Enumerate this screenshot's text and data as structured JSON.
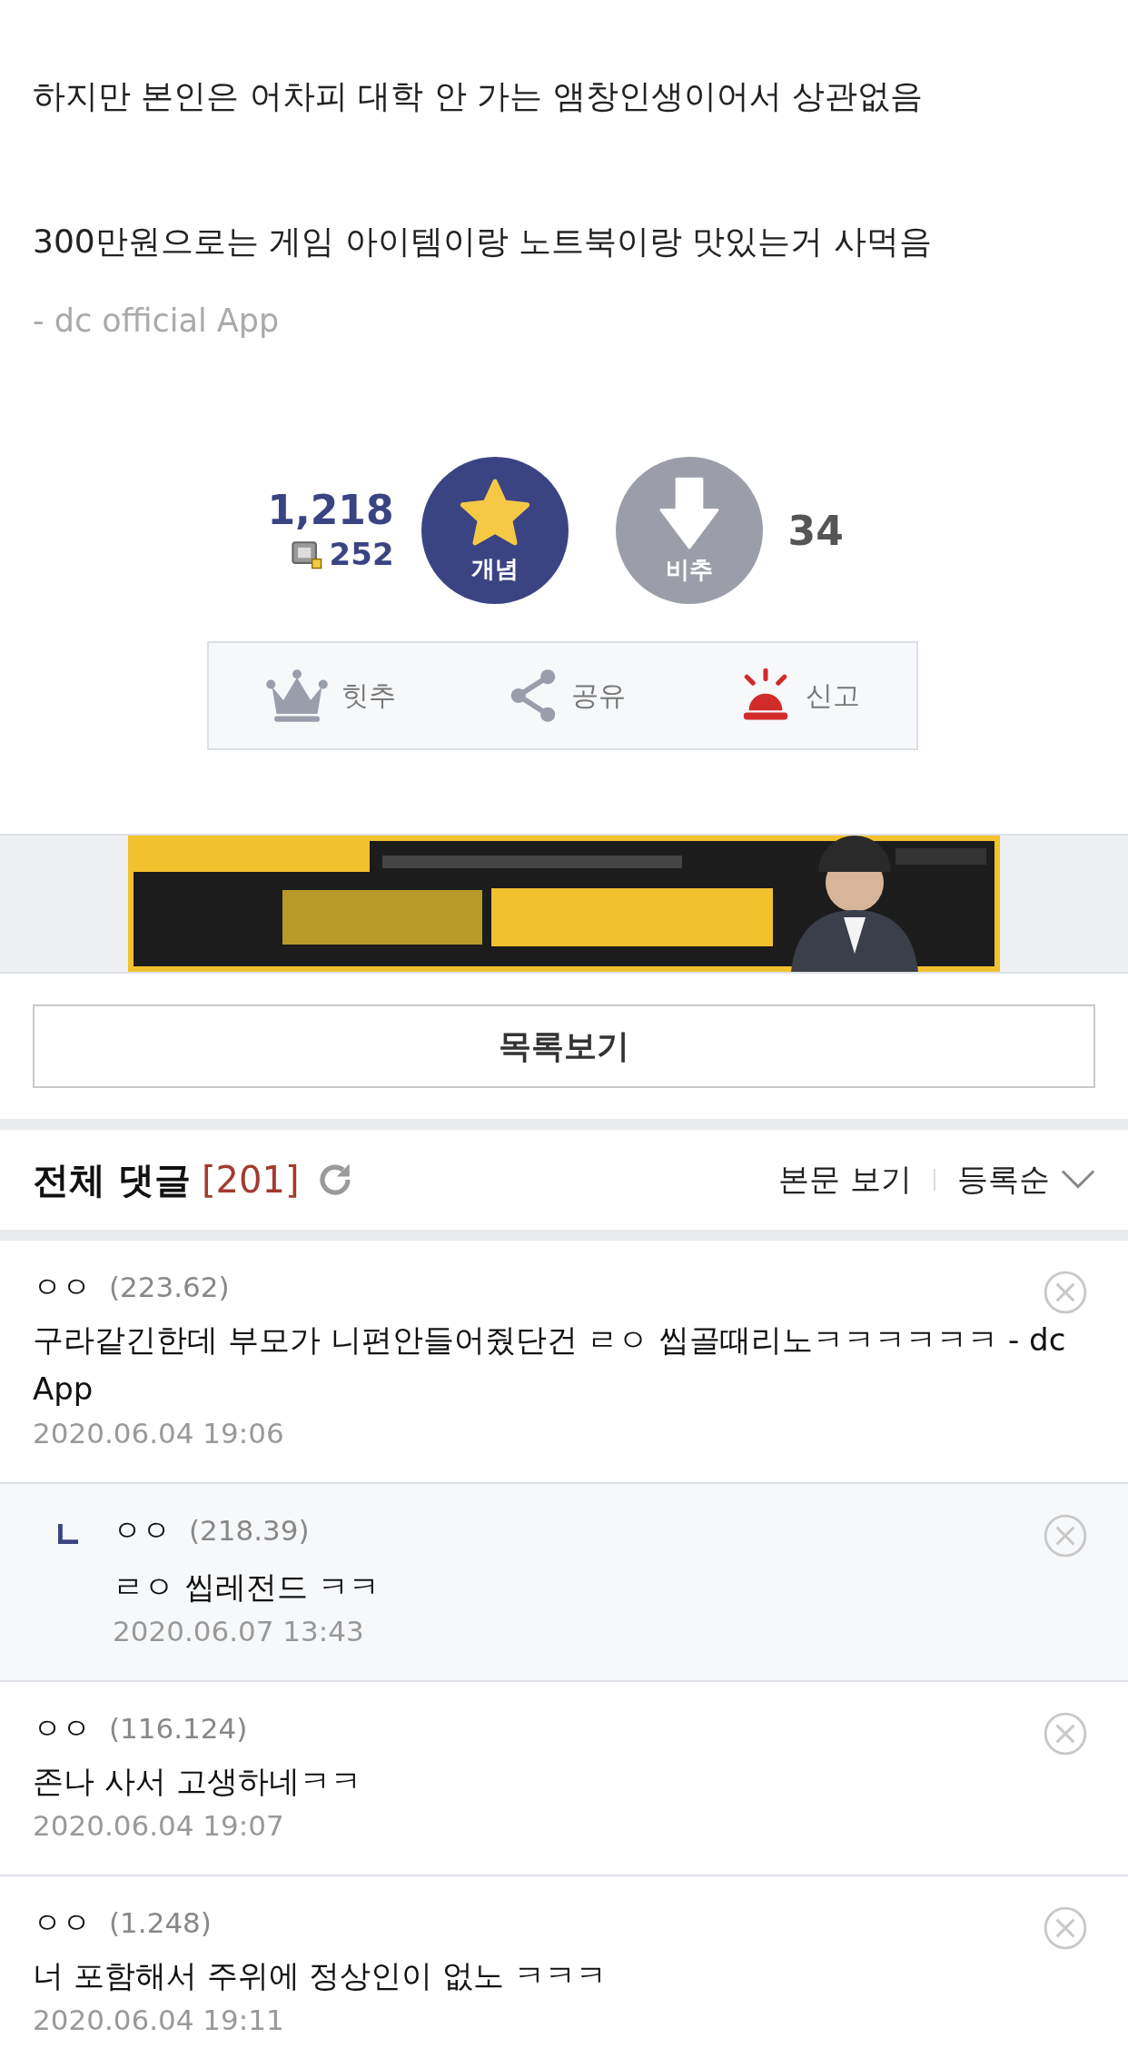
{
  "post": {
    "paragraphs": [
      "하지만 본인은 어차피 대학 안 가는 앰창인생이어서 상관없음",
      "300만원으로는 게임 아이템이랑 노트북이랑 맛있는거 사먹음"
    ],
    "signature": "- dc official App"
  },
  "votes": {
    "up_count": "1,218",
    "fixed_count": "252",
    "up_label": "개념",
    "down_label": "비추",
    "down_count": "34"
  },
  "actions": [
    {
      "kind": "hit",
      "label": "힛추"
    },
    {
      "kind": "share",
      "label": "공유"
    },
    {
      "kind": "report",
      "label": "신고"
    }
  ],
  "list_button": "목록보기",
  "comments_header": {
    "title": "전체 댓글",
    "count": "[201]",
    "view_post": "본문 보기",
    "sort": "등록순"
  },
  "comments": [
    {
      "kind": "comment",
      "author": "ㅇㅇ",
      "ip": "(223.62)",
      "text": "구라같긴한데 부모가 니편안들어줬단건 ㄹㅇ 씹골때리노ㅋㅋㅋㅋㅋㅋ - dc App",
      "date": "2020.06.04 19:06"
    },
    {
      "kind": "reply",
      "author": "ㅇㅇ",
      "ip": "(218.39)",
      "text": "ㄹㅇ 씹레전드 ㅋㅋ",
      "date": "2020.06.07 13:43"
    },
    {
      "kind": "comment",
      "author": "ㅇㅇ",
      "ip": "(116.124)",
      "text": "존나 사서 고생하네ㅋㅋ",
      "date": "2020.06.04 19:07"
    },
    {
      "kind": "comment",
      "author": "ㅇㅇ",
      "ip": "(1.248)",
      "text": "너 포함해서 주위에 정상인이 없노 ㅋㅋㅋ",
      "date": "2020.06.04 19:11"
    }
  ]
}
